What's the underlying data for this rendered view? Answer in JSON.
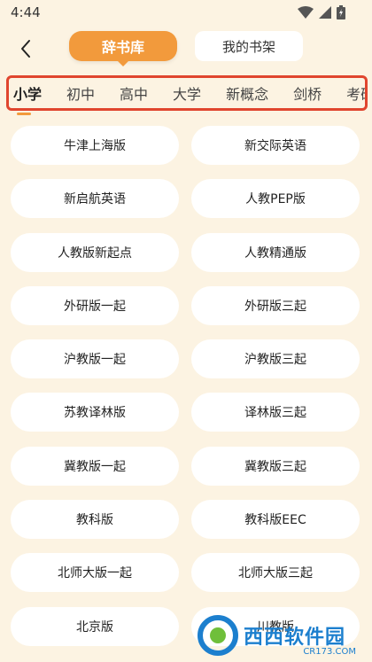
{
  "status": {
    "time": "4:44"
  },
  "header": {
    "back_icon": "chevron-left-icon",
    "tab_dictionary": "辞书库",
    "tab_bookshelf": "我的书架"
  },
  "categories": [
    "小学",
    "初中",
    "高中",
    "大学",
    "新概念",
    "剑桥",
    "考研"
  ],
  "active_category": "小学",
  "books": [
    [
      "牛津上海版",
      "新交际英语"
    ],
    [
      "新启航英语",
      "人教PEP版"
    ],
    [
      "人教版新起点",
      "人教精通版"
    ],
    [
      "外研版一起",
      "外研版三起"
    ],
    [
      "沪教版一起",
      "沪教版三起"
    ],
    [
      "苏教译林版",
      "译林版三起"
    ],
    [
      "冀教版一起",
      "冀教版三起"
    ],
    [
      "教科版",
      "教科版EEC"
    ],
    [
      "北师大版一起",
      "北师大版三起"
    ],
    [
      "北京版",
      "川教版"
    ]
  ],
  "watermark": {
    "name": "西西软件园",
    "url": "CR173.COM"
  },
  "colors": {
    "accent": "#f29a3c",
    "highlight_border": "#e0452e",
    "background": "#fcf3e2"
  }
}
